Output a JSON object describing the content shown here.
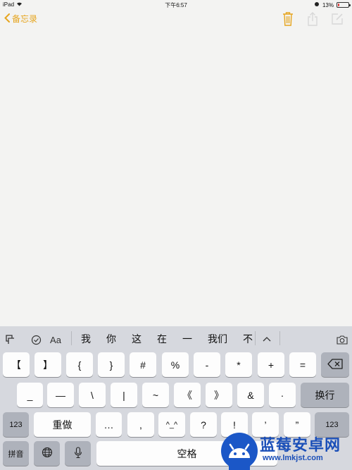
{
  "status": {
    "device": "iPad",
    "time": "下午6:57",
    "battery": "13%",
    "battery_level": 0.13,
    "battery_fill_color": "#dd3333"
  },
  "nav": {
    "back_label": "备忘录",
    "accent_color": "#e6a51f",
    "icons": [
      "trash-icon",
      "share-icon",
      "compose-icon"
    ]
  },
  "note": {
    "content": ""
  },
  "keyboard": {
    "candidate_bar": {
      "tools": [
        "cursor-icon",
        "checklist-icon",
        "Aa"
      ],
      "candidates": [
        "我",
        "你",
        "这",
        "在",
        "一",
        "我们",
        "不"
      ],
      "expand_icon": "chevron-up-icon",
      "camera_icon": "camera-icon"
    },
    "row1": [
      "【",
      "】",
      "{",
      "}",
      "#",
      "%",
      "-",
      "*",
      "+",
      "="
    ],
    "row2": [
      "_",
      "—",
      "\\",
      "|",
      "~",
      "《",
      "》",
      "&",
      "·"
    ],
    "row2_action": "换行",
    "row3_left": "123",
    "row3_redo": "重做",
    "row3": [
      "…",
      ",",
      "^_^",
      "?",
      "!",
      "’",
      "”"
    ],
    "row3_right": "123",
    "row4_mode": "拼音",
    "row4_space": "空格"
  },
  "watermark": {
    "brand": "蓝莓安卓网",
    "url": "www.lmkjst.com"
  }
}
